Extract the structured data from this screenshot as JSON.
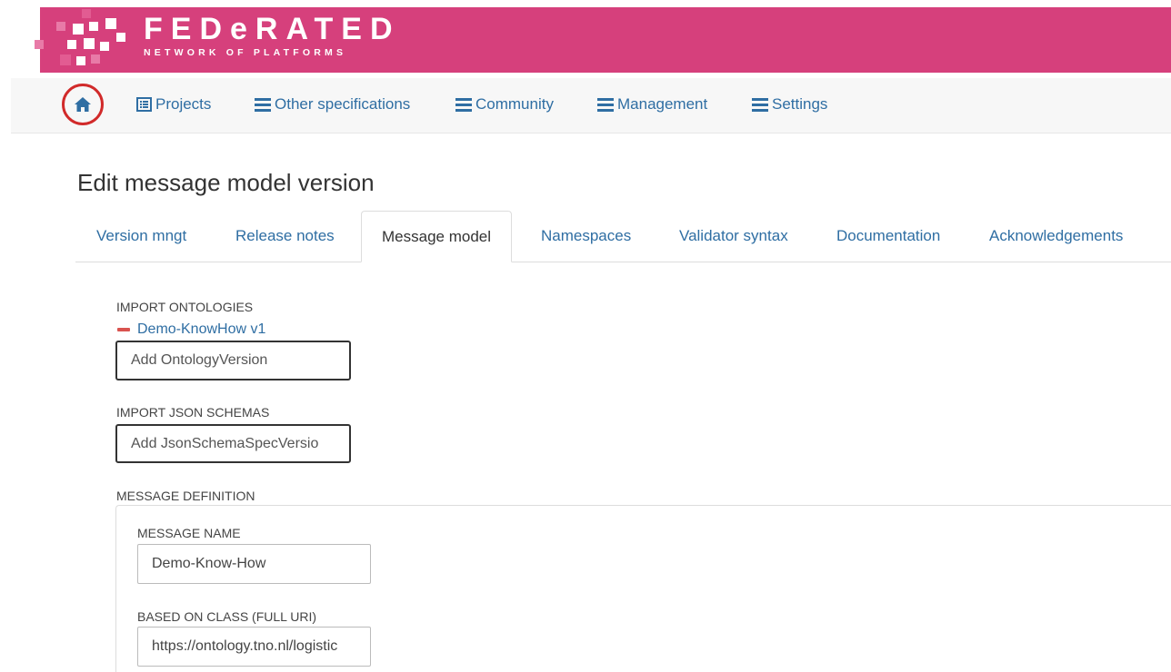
{
  "header": {
    "brand_title": "FEDeRATED",
    "brand_subtitle": "NETWORK OF PLATFORMS",
    "brand_color": "#d6407c"
  },
  "nav": {
    "home_icon": "home-icon",
    "items": [
      {
        "label": "Projects",
        "icon": "list-alt-icon"
      },
      {
        "label": "Other specifications",
        "icon": "menu-lines-icon"
      },
      {
        "label": "Community",
        "icon": "menu-lines-icon"
      },
      {
        "label": "Management",
        "icon": "menu-lines-icon"
      },
      {
        "label": "Settings",
        "icon": "menu-lines-icon"
      }
    ]
  },
  "page": {
    "title": "Edit message model version"
  },
  "tabs": [
    {
      "label": "Version mngt",
      "active": false
    },
    {
      "label": "Release notes",
      "active": false
    },
    {
      "label": "Message model",
      "active": true
    },
    {
      "label": "Namespaces",
      "active": false
    },
    {
      "label": "Validator syntax",
      "active": false
    },
    {
      "label": "Documentation",
      "active": false
    },
    {
      "label": "Acknowledgements",
      "active": false
    }
  ],
  "form": {
    "import_ontologies": {
      "label": "IMPORT ONTOLOGIES",
      "items": [
        "Demo-KnowHow v1"
      ],
      "placeholder": "Add OntologyVersion"
    },
    "import_json_schemas": {
      "label": "IMPORT JSON SCHEMAS",
      "placeholder": "Add JsonSchemaSpecVersio"
    },
    "message_definition": {
      "label": "MESSAGE DEFINITION",
      "message_name": {
        "label": "MESSAGE NAME",
        "value": "Demo-Know-How"
      },
      "based_on_class": {
        "label": "BASED ON CLASS (FULL URI)",
        "value": "https://ontology.tno.nl/logistic"
      }
    }
  }
}
